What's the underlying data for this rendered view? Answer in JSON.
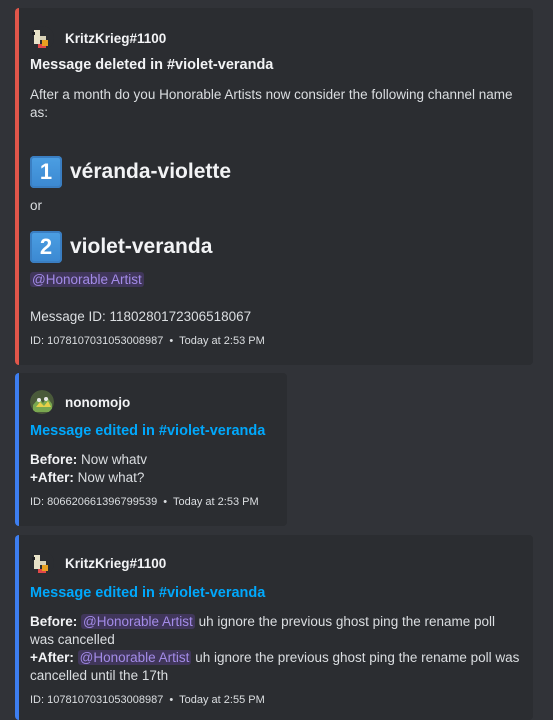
{
  "colors": {
    "background": "#313338",
    "embed_background": "#2b2d31",
    "red_bar": "#e0564a",
    "blue_bar": "#3d7ef0",
    "link": "#00a8fc",
    "mention_purple": "#a38be8"
  },
  "embeds": [
    {
      "author": "KritzKrieg#1100",
      "avatar_icon": "pixel-avatar-icon",
      "title": "Message deleted in #violet-veranda",
      "body": "After a month do you Honorable Artists now consider the following channel name as:",
      "option1_number": "1",
      "option1_text": "véranda-violette",
      "or_text": "or",
      "option2_number": "2",
      "option2_text": "violet-veranda",
      "mention": "@Honorable Artist",
      "message_id_line": "Message ID: 1180280172306518067",
      "footer_id": "ID: 1078107031053008987",
      "footer_time": "Today at 2:53 PM"
    },
    {
      "author": "nonomojo",
      "avatar_icon": "green-avatar-icon",
      "title": "Message edited in #violet-veranda",
      "before_label": "Before:",
      "before_text": "Now whatv",
      "after_label": "+After:",
      "after_text": "Now what?",
      "footer_id": "ID: 806620661396799539",
      "footer_time": "Today at 2:53 PM"
    },
    {
      "author": "KritzKrieg#1100",
      "avatar_icon": "pixel-avatar-icon",
      "title": "Message edited in #violet-veranda",
      "before_label": "Before:",
      "before_mention": "@Honorable Artist",
      "before_text": "uh ignore the previous ghost ping the rename poll was cancelled",
      "after_label": "+After:",
      "after_mention": "@Honorable Artist",
      "after_text": "uh ignore the previous ghost ping the rename poll was cancelled until the 17th",
      "footer_id": "ID: 1078107031053008987",
      "footer_time": "Today at 2:55 PM"
    }
  ],
  "footer_separator": "•"
}
